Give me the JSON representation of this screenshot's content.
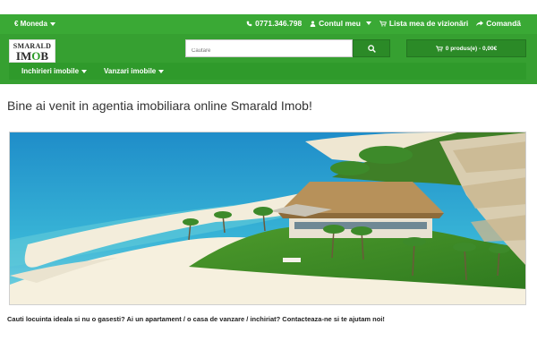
{
  "topbar": {
    "currency_label": "€ Moneda",
    "phone": "0771.346.798",
    "account_label": "Contul meu",
    "wishlist_label": "Lista mea de vizionări",
    "checkout_label": "Comandă"
  },
  "logo": {
    "line1": "SMARALD",
    "line2_a": "IM",
    "line2_o": "O",
    "line2_b": "B"
  },
  "search": {
    "placeholder": "Căutare"
  },
  "cart": {
    "label": "0 produs(e) - 0,00€"
  },
  "nav": {
    "items": [
      {
        "label": "Inchirieri imobile"
      },
      {
        "label": "Vanzari imobile"
      }
    ]
  },
  "main": {
    "welcome": "Bine ai venit in agentia imobiliara online Smarald Imob!",
    "tagline": "Cauti locuinta ideala si nu o gasesti? Ai un apartament / o casa de vanzare / inchiriat? Contacteaza-ne si te ajutam noi!"
  },
  "colors": {
    "brand_green": "#3aa935",
    "dark_green": "#2b8a27"
  },
  "icons": [
    "phone-icon",
    "user-icon",
    "cart-icon",
    "share-icon",
    "search-icon"
  ]
}
